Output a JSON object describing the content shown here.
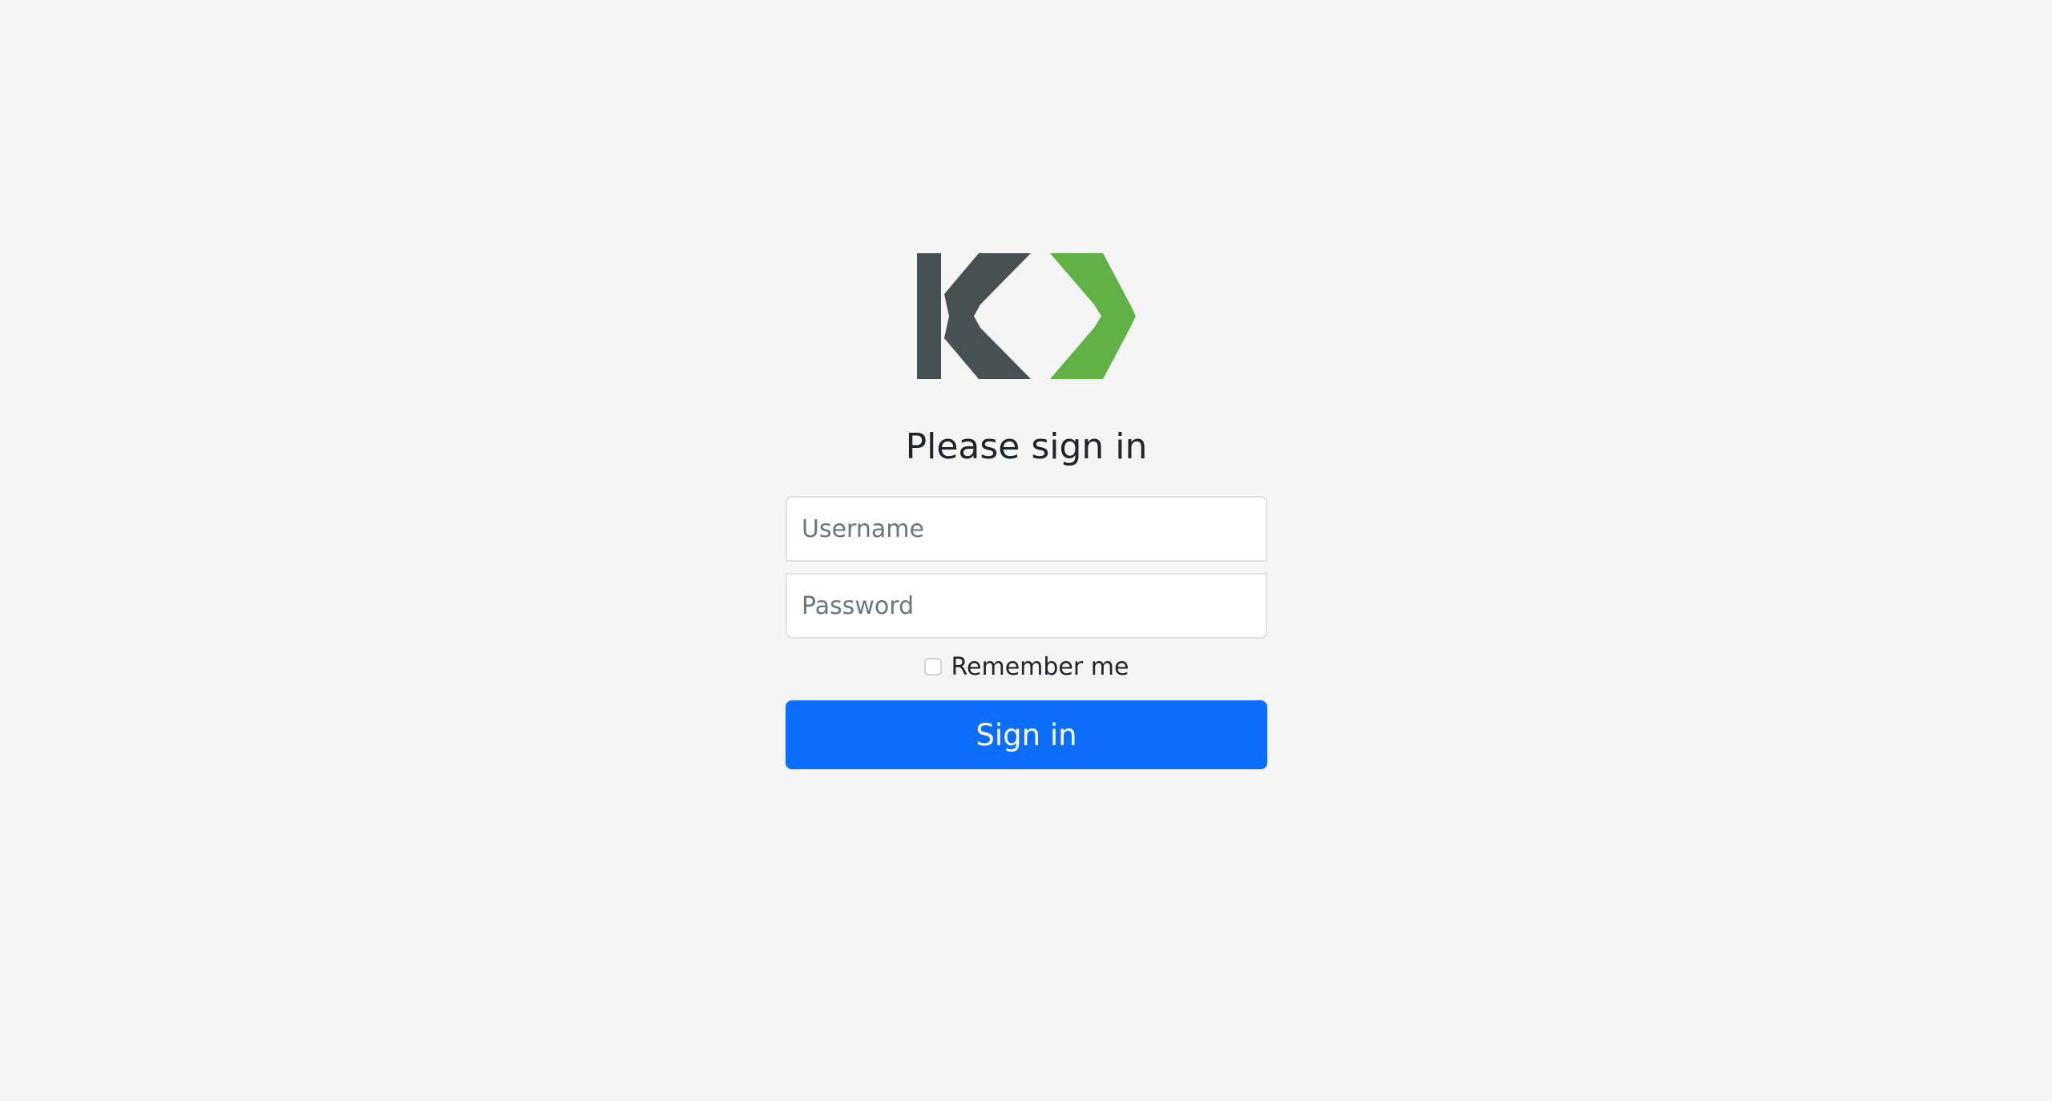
{
  "brand": {
    "logo_name": "K logo",
    "colors": {
      "dark": "#475052",
      "green": "#62b146"
    }
  },
  "form": {
    "heading": "Please sign in",
    "username": {
      "placeholder": "Username",
      "value": ""
    },
    "password": {
      "placeholder": "Password",
      "value": ""
    },
    "remember": {
      "label": "Remember me",
      "checked": false
    },
    "submit_label": "Sign in"
  },
  "colors": {
    "page_background": "#f5f5f5",
    "primary": "#0d6efd"
  }
}
